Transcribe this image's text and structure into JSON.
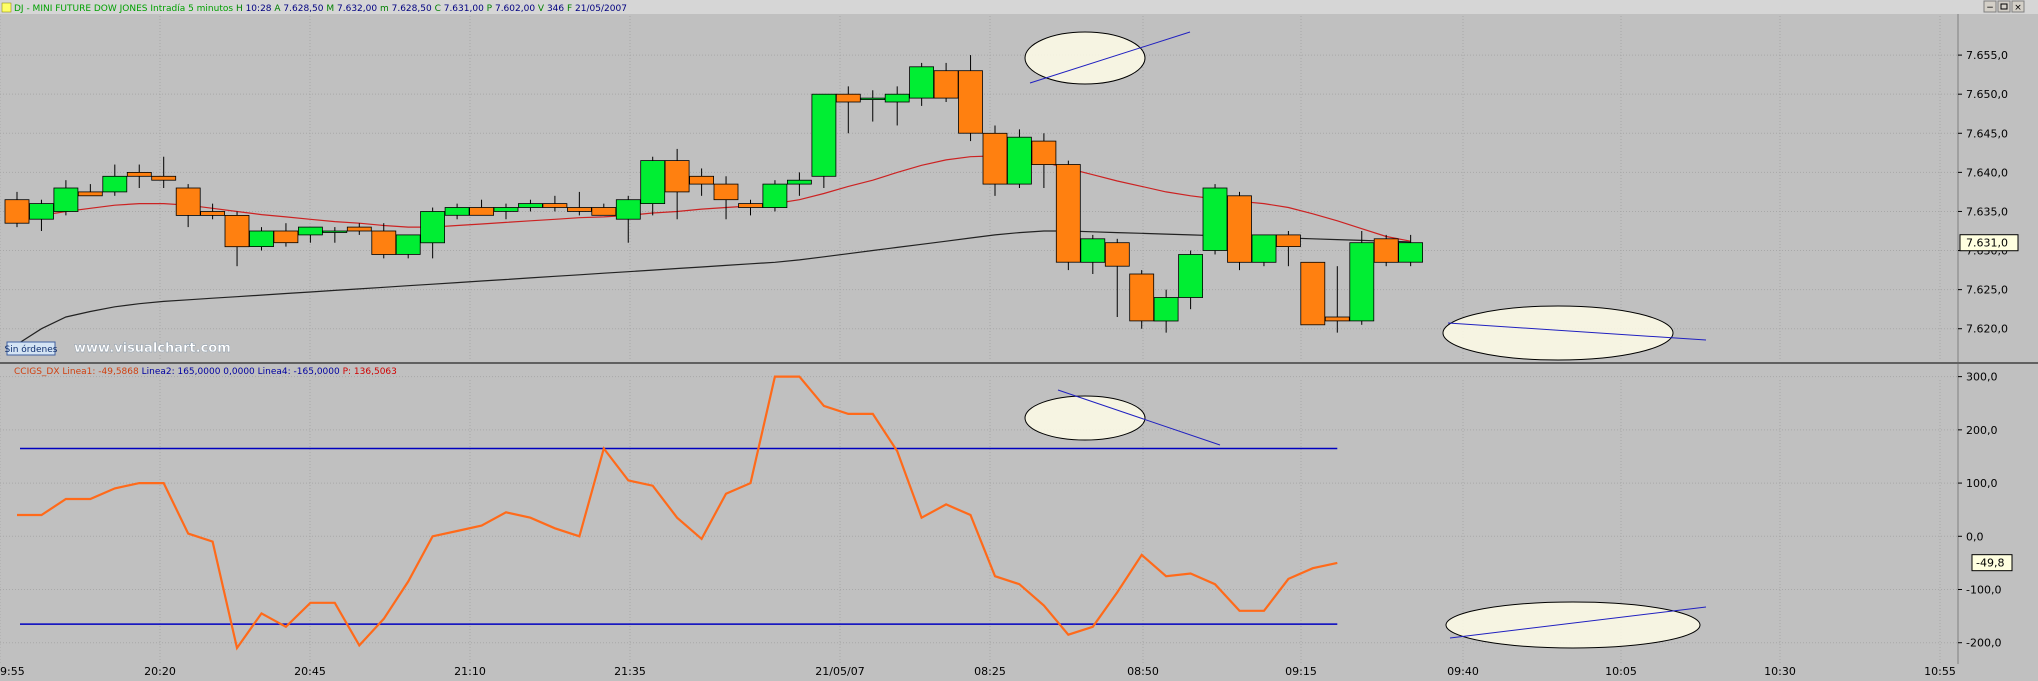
{
  "header": {
    "instrument": "DJ - MINI FUTURE DOW JONES",
    "timeframe": "Intradía 5 minutos",
    "fields": [
      {
        "label": "H",
        "value": "10:28"
      },
      {
        "label": "A",
        "value": "7.628,50"
      },
      {
        "label": "M",
        "value": "7.632,00"
      },
      {
        "label": "m",
        "value": "7.628,50"
      },
      {
        "label": "C",
        "value": "7.631,00"
      },
      {
        "label": "P",
        "value": "7.602,00"
      },
      {
        "label": "V",
        "value": "346"
      },
      {
        "label": "F",
        "value": "21/05/2007"
      }
    ]
  },
  "badge": {
    "label": "Sin órdenes"
  },
  "watermark": "www.visualchart.com",
  "indicator_header": {
    "name": "CCIGS_DX",
    "fields": [
      {
        "label": "Linea1",
        "value": "-49,5868",
        "color": "#d04010"
      },
      {
        "label": "Linea2",
        "value": "165,0000",
        "color": "#0000a0"
      },
      {
        "label": "",
        "value": "0,0000",
        "color": "#0000a0"
      },
      {
        "label": "Linea4",
        "value": "-165,0000",
        "color": "#0000a0"
      },
      {
        "label": "P",
        "value": "136,5063",
        "color": "#d00000"
      }
    ]
  },
  "colors": {
    "up_candle": "#00ee33",
    "down_candle": "#ff8010",
    "ma_fast": "#cc2222",
    "ma_slow": "#222222",
    "cci_line": "#ff6a1a",
    "band_line": "#0000c0",
    "panel_bg": "#c0c0c0",
    "header_bg": "#d6d6d6"
  },
  "chart_data": [
    {
      "type": "candlestick",
      "ylim": [
        7616,
        7660
      ],
      "y_ticks": [
        "7.620,0",
        "7.625,0",
        "7.630,0",
        "7.635,0",
        "7.640,0",
        "7.645,0",
        "7.650,0",
        "7.655,0"
      ],
      "x_ticks": [
        "9:55",
        "20:20",
        "20:45",
        "21:10",
        "21:35",
        "21/05/07",
        "08:25",
        "08:50",
        "09:15",
        "09:40",
        "10:05",
        "10:30",
        "10:55"
      ],
      "last_price_label": "7.631,0",
      "last_price": 7631,
      "candles": [
        {
          "o": 7636.5,
          "h": 7637.5,
          "l": 7633,
          "c": 7633.5
        },
        {
          "o": 7634,
          "h": 7636.5,
          "l": 7632.5,
          "c": 7636
        },
        {
          "o": 7635,
          "h": 7639,
          "l": 7634.5,
          "c": 7638
        },
        {
          "o": 7637.5,
          "h": 7638.5,
          "l": 7637,
          "c": 7637
        },
        {
          "o": 7637.5,
          "h": 7641,
          "l": 7637,
          "c": 7639.5
        },
        {
          "o": 7640,
          "h": 7641,
          "l": 7638,
          "c": 7639.5
        },
        {
          "o": 7639.5,
          "h": 7642,
          "l": 7638,
          "c": 7639
        },
        {
          "o": 7638,
          "h": 7638.5,
          "l": 7633,
          "c": 7634.5
        },
        {
          "o": 7635,
          "h": 7636,
          "l": 7634,
          "c": 7634.5
        },
        {
          "o": 7634.5,
          "h": 7635,
          "l": 7628,
          "c": 7630.5
        },
        {
          "o": 7630.5,
          "h": 7633,
          "l": 7630,
          "c": 7632.5
        },
        {
          "o": 7632.5,
          "h": 7633.5,
          "l": 7630.5,
          "c": 7631
        },
        {
          "o": 7632,
          "h": 7633,
          "l": 7631,
          "c": 7633
        },
        {
          "o": 7632.5,
          "h": 7633,
          "l": 7631,
          "c": 7632.5
        },
        {
          "o": 7633,
          "h": 7633.5,
          "l": 7632,
          "c": 7632.5
        },
        {
          "o": 7632.5,
          "h": 7633.5,
          "l": 7629,
          "c": 7629.5
        },
        {
          "o": 7629.5,
          "h": 7632,
          "l": 7629,
          "c": 7632
        },
        {
          "o": 7631,
          "h": 7635.5,
          "l": 7629,
          "c": 7635
        },
        {
          "o": 7634.5,
          "h": 7636,
          "l": 7634,
          "c": 7635.5
        },
        {
          "o": 7635.5,
          "h": 7636.5,
          "l": 7634.5,
          "c": 7634.5
        },
        {
          "o": 7635,
          "h": 7636,
          "l": 7634,
          "c": 7635.5
        },
        {
          "o": 7635.5,
          "h": 7636.5,
          "l": 7635,
          "c": 7636
        },
        {
          "o": 7636,
          "h": 7637,
          "l": 7635,
          "c": 7635.5
        },
        {
          "o": 7635.5,
          "h": 7637.5,
          "l": 7634.5,
          "c": 7635
        },
        {
          "o": 7635.5,
          "h": 7636,
          "l": 7634.5,
          "c": 7634.5
        },
        {
          "o": 7634,
          "h": 7637,
          "l": 7631,
          "c": 7636.5
        },
        {
          "o": 7636,
          "h": 7642,
          "l": 7634.5,
          "c": 7641.5
        },
        {
          "o": 7641.5,
          "h": 7643,
          "l": 7634,
          "c": 7637.5
        },
        {
          "o": 7639.5,
          "h": 7640.5,
          "l": 7637,
          "c": 7638.5
        },
        {
          "o": 7638.5,
          "h": 7639.5,
          "l": 7634,
          "c": 7636.5
        },
        {
          "o": 7636,
          "h": 7636.5,
          "l": 7634.5,
          "c": 7635.5
        },
        {
          "o": 7635.5,
          "h": 7639,
          "l": 7635,
          "c": 7638.5
        },
        {
          "o": 7638.5,
          "h": 7640,
          "l": 7637,
          "c": 7639
        },
        {
          "o": 7639.5,
          "h": 7650,
          "l": 7638,
          "c": 7650
        },
        {
          "o": 7650,
          "h": 7651,
          "l": 7645,
          "c": 7649
        },
        {
          "o": 7649.5,
          "h": 7650.5,
          "l": 7646.5,
          "c": 7649.5
        },
        {
          "o": 7649,
          "h": 7651,
          "l": 7646,
          "c": 7650
        },
        {
          "o": 7649.5,
          "h": 7654,
          "l": 7648.5,
          "c": 7653.5
        },
        {
          "o": 7653,
          "h": 7654,
          "l": 7649,
          "c": 7649.5
        },
        {
          "o": 7653,
          "h": 7655,
          "l": 7644,
          "c": 7645
        },
        {
          "o": 7645,
          "h": 7646,
          "l": 7637,
          "c": 7638.5
        },
        {
          "o": 7638.5,
          "h": 7645.5,
          "l": 7638,
          "c": 7644.5
        },
        {
          "o": 7644,
          "h": 7645,
          "l": 7638,
          "c": 7641
        },
        {
          "o": 7641,
          "h": 7641.5,
          "l": 7627.5,
          "c": 7628.5
        },
        {
          "o": 7628.5,
          "h": 7632,
          "l": 7627,
          "c": 7631.5
        },
        {
          "o": 7631,
          "h": 7631.5,
          "l": 7621.5,
          "c": 7628
        },
        {
          "o": 7627,
          "h": 7627.5,
          "l": 7620,
          "c": 7621
        },
        {
          "o": 7621,
          "h": 7625,
          "l": 7619.5,
          "c": 7624
        },
        {
          "o": 7624,
          "h": 7630,
          "l": 7622.5,
          "c": 7629.5
        },
        {
          "o": 7630,
          "h": 7638.5,
          "l": 7629.5,
          "c": 7638
        },
        {
          "o": 7637,
          "h": 7637.5,
          "l": 7627.5,
          "c": 7628.5
        },
        {
          "o": 7628.5,
          "h": 7632,
          "l": 7628,
          "c": 7632
        },
        {
          "o": 7632,
          "h": 7632.5,
          "l": 7628,
          "c": 7630.5
        },
        {
          "o": 7628.5,
          "h": 7628.5,
          "l": 7620.5,
          "c": 7620.5
        },
        {
          "o": 7621.5,
          "h": 7628,
          "l": 7619.5,
          "c": 7621
        },
        {
          "o": 7621,
          "h": 7632.5,
          "l": 7620.5,
          "c": 7631
        },
        {
          "o": 7631.5,
          "h": 7632,
          "l": 7628,
          "c": 7628.5
        },
        {
          "o": 7628.5,
          "h": 7632,
          "l": 7628,
          "c": 7631
        }
      ],
      "ma_fast": [
        7634,
        7634.5,
        7635,
        7635.4,
        7635.8,
        7636,
        7636,
        7635.8,
        7635.4,
        7635,
        7634.6,
        7634.3,
        7634,
        7633.7,
        7633.5,
        7633.2,
        7633,
        7633,
        7633.2,
        7633.4,
        7633.6,
        7633.8,
        7634,
        7634.2,
        7634.3,
        7634.5,
        7634.8,
        7635,
        7635.3,
        7635.5,
        7635.7,
        7636,
        7636.5,
        7637.3,
        7638.2,
        7639,
        7640,
        7640.9,
        7641.6,
        7642,
        7642.1,
        7641.8,
        7641.3,
        7640.5,
        7639.7,
        7638.9,
        7638.2,
        7637.5,
        7637,
        7636.6,
        7636.3,
        7636,
        7635.5,
        7634.7,
        7633.8,
        7632.8,
        7631.8,
        7631.2
      ],
      "ma_slow": [
        7618,
        7620,
        7621.5,
        7622.2,
        7622.8,
        7623.2,
        7623.5,
        7623.7,
        7623.9,
        7624.1,
        7624.3,
        7624.5,
        7624.7,
        7624.9,
        7625.1,
        7625.3,
        7625.5,
        7625.7,
        7625.9,
        7626.1,
        7626.3,
        7626.5,
        7626.7,
        7626.9,
        7627.1,
        7627.3,
        7627.5,
        7627.7,
        7627.9,
        7628.1,
        7628.3,
        7628.5,
        7628.8,
        7629.2,
        7629.6,
        7630,
        7630.4,
        7630.8,
        7631.2,
        7631.6,
        7632,
        7632.3,
        7632.5,
        7632.5,
        7632.4,
        7632.3,
        7632.2,
        7632.1,
        7632,
        7631.9,
        7631.8,
        7631.7,
        7631.6,
        7631.5,
        7631.4,
        7631.3,
        7631.2,
        7631.1
      ]
    },
    {
      "type": "line",
      "ylim": [
        -240,
        320
      ],
      "y_ticks": [
        "-200,0",
        "-100,0",
        "0,0",
        "100,0",
        "200,0",
        "300,0"
      ],
      "last_value_label": "-49,8",
      "last_value": -49.6,
      "series": [
        {
          "values": [
            40,
            40,
            70,
            70,
            90,
            100,
            100,
            5,
            -10,
            -210,
            -145,
            -170,
            -125,
            -125,
            -205,
            -155,
            -85,
            0,
            10,
            20,
            45,
            35,
            15,
            0,
            165,
            105,
            95,
            35,
            -5,
            80,
            100,
            300,
            300,
            245,
            230,
            230,
            160,
            35,
            60,
            40,
            -75,
            -90,
            -130,
            -185,
            -170,
            -105,
            -35,
            -75,
            -70,
            -90,
            -140,
            -140,
            -80,
            -60,
            -50
          ]
        }
      ],
      "bands": [
        165,
        -165
      ],
      "bands_end_index": 54
    }
  ]
}
